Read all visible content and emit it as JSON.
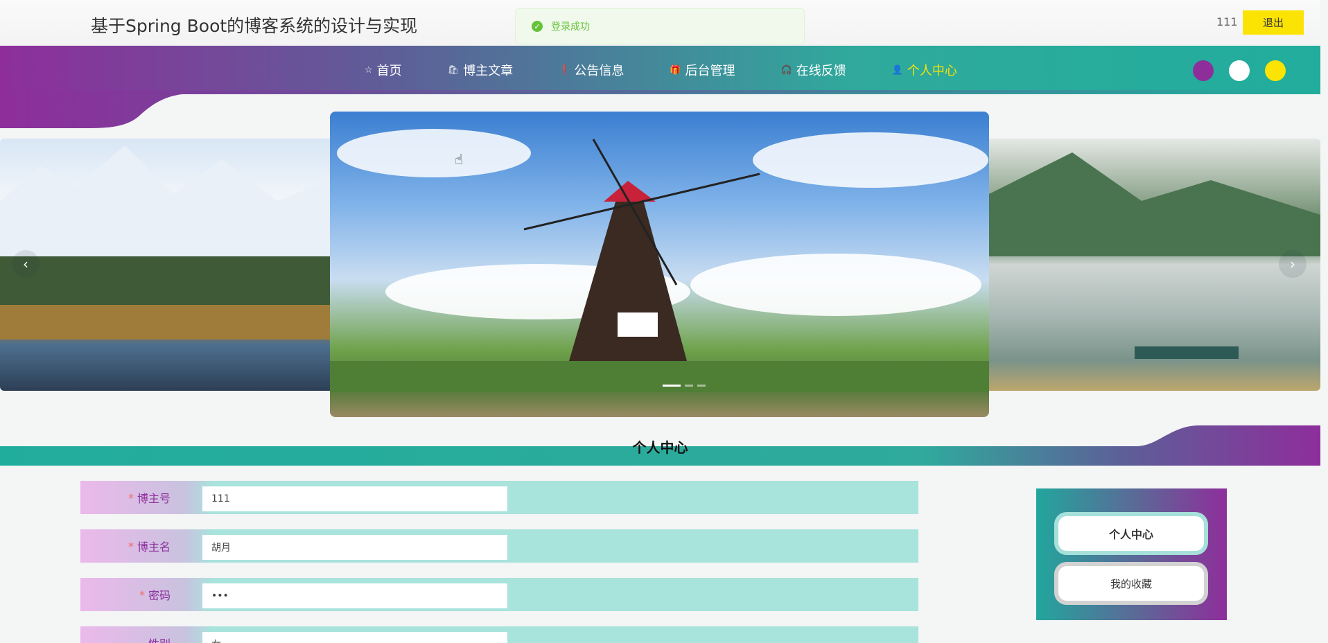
{
  "header": {
    "site_title": "基于Spring Boot的博客系统的设计与实现",
    "user_name": "111",
    "logout_label": "退出"
  },
  "toast": {
    "message": "登录成功",
    "icon": "check-circle-icon",
    "color": "#67c23a"
  },
  "nav": {
    "items": [
      {
        "label": "首页",
        "icon": "star-icon"
      },
      {
        "label": "博主文章",
        "icon": "bag-icon"
      },
      {
        "label": "公告信息",
        "icon": "info-icon"
      },
      {
        "label": "后台管理",
        "icon": "gift-icon"
      },
      {
        "label": "在线反馈",
        "icon": "headset-icon"
      },
      {
        "label": "个人中心",
        "icon": "user-icon",
        "active": true
      }
    ],
    "active_color": "#fbe304",
    "theme_colors": [
      "#8e2e9b",
      "#ffffff",
      "#fbe304"
    ]
  },
  "carousel": {
    "slides": [
      "mountain-lake",
      "windmill",
      "river-boat"
    ],
    "active_index": 1,
    "prev_icon": "chevron-left-icon",
    "next_icon": "chevron-right-icon"
  },
  "section": {
    "title": "个人中心"
  },
  "form": {
    "fields": [
      {
        "label": "博主号",
        "value": "111",
        "required": true
      },
      {
        "label": "博主名",
        "value": "胡月",
        "required": true
      },
      {
        "label": "密码",
        "value": "•••",
        "required": true
      },
      {
        "label": "性别",
        "value": "女",
        "required": false
      }
    ]
  },
  "side_menu": {
    "items": [
      {
        "label": "个人中心",
        "active": true
      },
      {
        "label": "我的收藏",
        "active": false
      }
    ]
  }
}
